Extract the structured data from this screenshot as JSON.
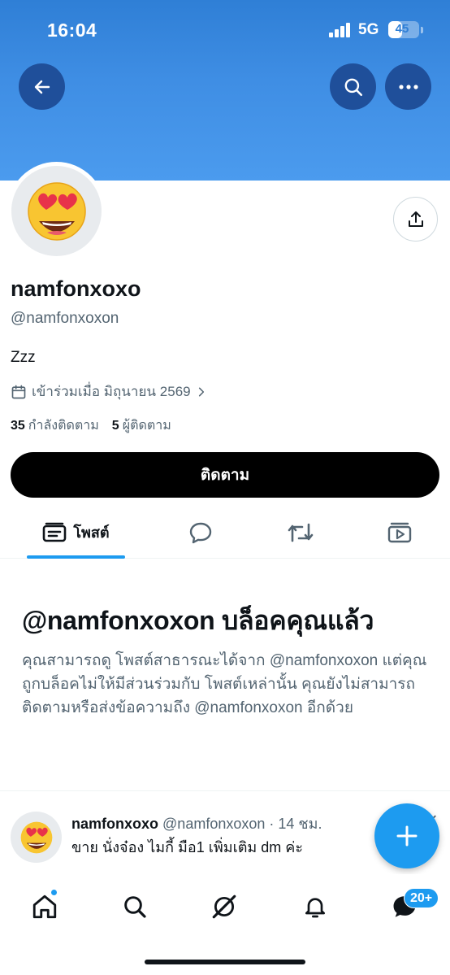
{
  "status_bar": {
    "time": "16:04",
    "network": "5G",
    "battery": "45",
    "battery_level_percent": 45
  },
  "header": {
    "back_icon": "arrow-left-icon",
    "search_icon": "search-icon",
    "more_icon": "more-horizontal-icon",
    "banner_color": "#3f8ee4"
  },
  "profile": {
    "avatar_icon": "heart-eyes-emoji",
    "display_name": "namfonxoxo",
    "handle": "@namfonxoxon",
    "bio": "Zzz",
    "joined": "เข้าร่วมเมื่อ มิถุนายน 2569",
    "following_count": "35",
    "following_label": "กำลังติดตาม",
    "followers_count": "5",
    "followers_label": "ผู้ติดตาม",
    "follow_button": "ติดตาม"
  },
  "tabs": [
    {
      "label": "โพสต์",
      "icon": "posts-icon",
      "active": true
    },
    {
      "label": "",
      "icon": "reply-icon",
      "active": false
    },
    {
      "label": "",
      "icon": "repost-icon",
      "active": false
    },
    {
      "label": "",
      "icon": "media-icon",
      "active": false
    }
  ],
  "blocked": {
    "title": "@namfonxoxon บล็อคคุณแล้ว",
    "body": "คุณสามารถดู โพสต์สาธารณะได้จาก @namfonxoxon แต่คุณถูกบล็อคไม่ให้มีส่วนร่วมกับ โพสต์เหล่านั้น คุณยังไม่สามารถติดตามหรือส่งข้อความถึง @namfonxoxon อีกด้วย"
  },
  "tweet": {
    "name": "namfonxoxo",
    "meta": "@namfonxoxon · 14 ชม.",
    "text": "ขาย นั่งจ๋อง ไมกี้ มือ1 เพิ่มเติม dm ค่ะ"
  },
  "fab": {
    "icon": "plus-icon"
  },
  "bottom_nav": {
    "items": [
      "home-icon",
      "search-icon",
      "grok-icon",
      "notifications-icon",
      "messages-icon"
    ],
    "messages_badge": "20+",
    "accent": "#1d9bf0"
  }
}
